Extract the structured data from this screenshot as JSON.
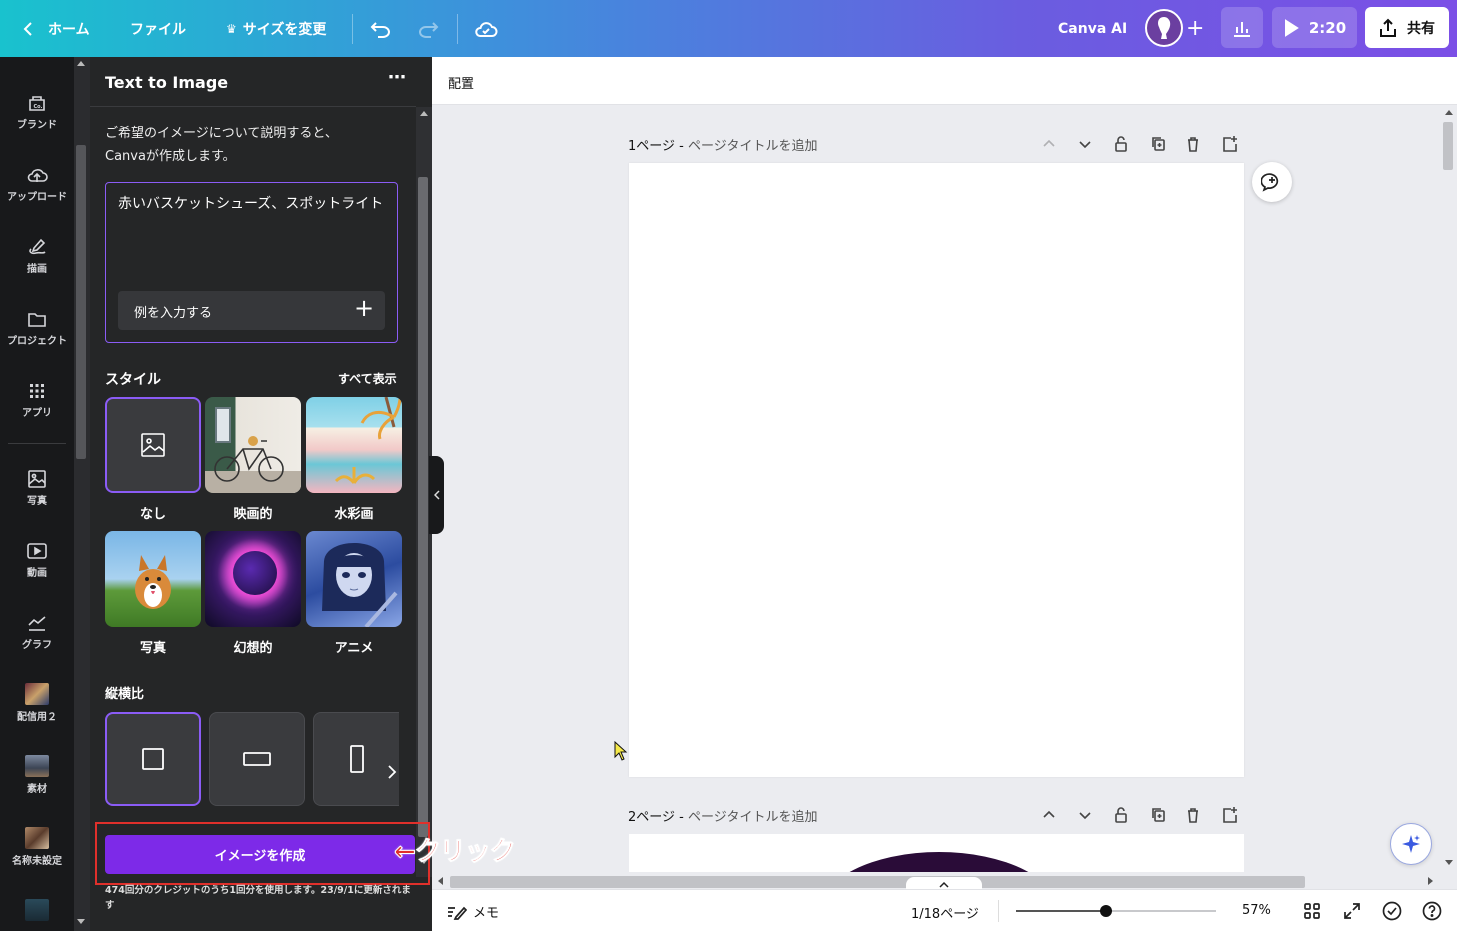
{
  "topbar": {
    "home_label": "ホーム",
    "file_label": "ファイル",
    "resize_label": "サイズを変更",
    "canva_ai_label": "Canva AI",
    "present_time": "2:20",
    "share_label": "共有"
  },
  "rail": {
    "items": [
      {
        "label": "ブランド",
        "icon": "brand-icon"
      },
      {
        "label": "アップロード",
        "icon": "upload-icon"
      },
      {
        "label": "描画",
        "icon": "draw-icon"
      },
      {
        "label": "プロジェクト",
        "icon": "folder-icon"
      },
      {
        "label": "アプリ",
        "icon": "apps-icon"
      },
      {
        "label": "写真",
        "icon": "photo-icon"
      },
      {
        "label": "動画",
        "icon": "video-icon"
      },
      {
        "label": "グラフ",
        "icon": "graph-icon"
      },
      {
        "label": "配信用２",
        "icon": "folder-thumb-icon"
      },
      {
        "label": "素材",
        "icon": "folder-thumb-icon"
      },
      {
        "label": "名称未設定",
        "icon": "folder-thumb-icon"
      }
    ]
  },
  "panel": {
    "title": "Text to Image",
    "description": "ご希望のイメージについて説明すると、Canvaが作成します。",
    "prompt_value": "赤いバスケットシューズ、スポットライト",
    "example_button": "例を入力する",
    "style_heading": "スタイル",
    "see_all": "すべて表示",
    "styles": [
      {
        "label": "なし"
      },
      {
        "label": "映画的"
      },
      {
        "label": "水彩画"
      },
      {
        "label": "写真"
      },
      {
        "label": "幻想的"
      },
      {
        "label": "アニメ"
      }
    ],
    "aspect_heading": "縦横比",
    "create_button": "イメージを作成",
    "credit_note": "474回分のクレジットのうち1回分を使用します。23/9/1に更新されます",
    "annotation": "←クリック"
  },
  "canvas": {
    "toolbar_label": "配置",
    "page1_number": "1ページ",
    "page1_title_placeholder": "ページタイトルを追加",
    "page2_number": "2ページ",
    "page2_title_placeholder": "ページタイトルを追加",
    "separator": " - "
  },
  "footer": {
    "notes_label": "メモ",
    "page_indicator": "1/18ページ",
    "zoom": "57%",
    "zoom_level": 0.57
  },
  "colors": {
    "accent": "#7d2ae8",
    "annotation_red": "#e0302b"
  }
}
